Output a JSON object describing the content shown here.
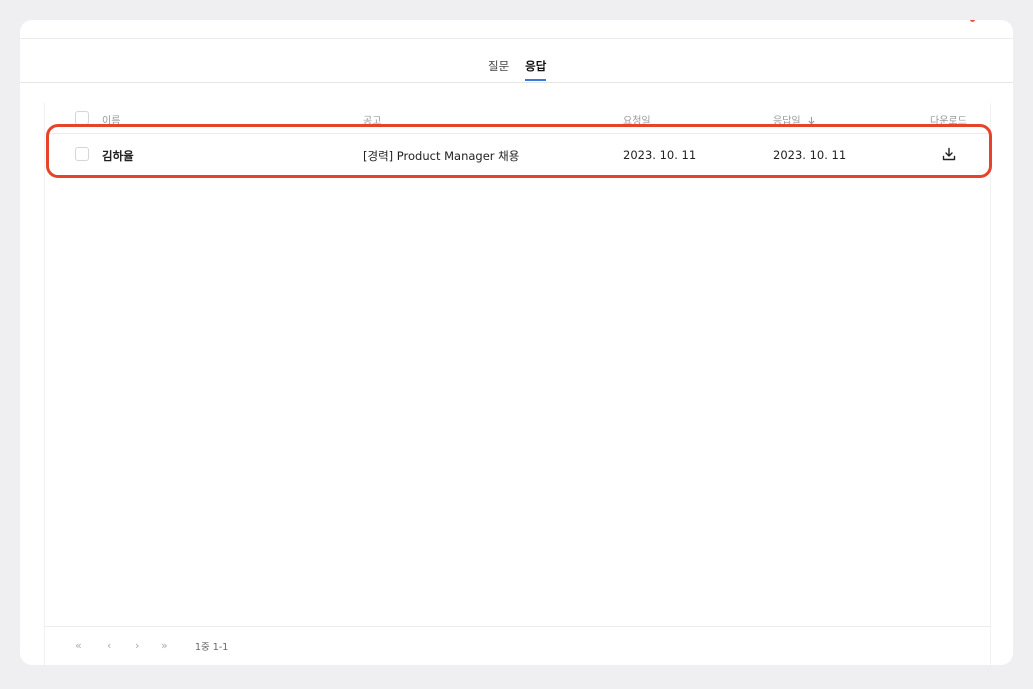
{
  "tabs": [
    {
      "label": "질문",
      "active": false
    },
    {
      "label": "응답",
      "active": true
    }
  ],
  "table": {
    "headers": {
      "name": "이름",
      "posting": "공고",
      "requested": "요청일",
      "responded": "응답일",
      "sort_icon": "arrow-down-icon",
      "download": "다운로드"
    },
    "rows": [
      {
        "name": "김하율",
        "posting": "[경력] Product Manager 채용",
        "requested": "2023. 10. 11",
        "responded": "2023. 10. 11",
        "download_icon": "download-icon"
      }
    ]
  },
  "pagination": {
    "first": "«",
    "prev": "‹",
    "next": "›",
    "last": "»",
    "info": "1중  1-1"
  },
  "colors": {
    "accent": "#3b7bd6",
    "highlight": "#e5432a",
    "background": "#efeff1"
  }
}
